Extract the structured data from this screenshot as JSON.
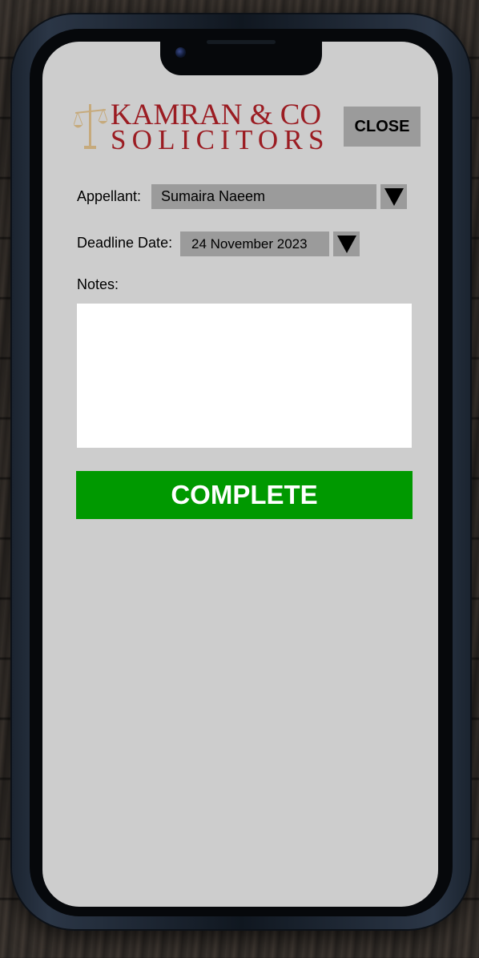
{
  "brand": {
    "line1": "KAMRAN & CO",
    "line2": "SOLICITORS",
    "logo_icon": "scales-of-justice-icon",
    "color": "#9b1c22"
  },
  "header": {
    "close_label": "CLOSE"
  },
  "form": {
    "appellant_label": "Appellant:",
    "appellant_value": "Sumaira Naeem",
    "deadline_label": "Deadline Date:",
    "deadline_value": "24 November 2023",
    "notes_label": "Notes:",
    "notes_value": "",
    "dropdown_icon": "triangle-down-icon"
  },
  "actions": {
    "complete_label": "COMPLETE",
    "complete_color": "#009900"
  }
}
